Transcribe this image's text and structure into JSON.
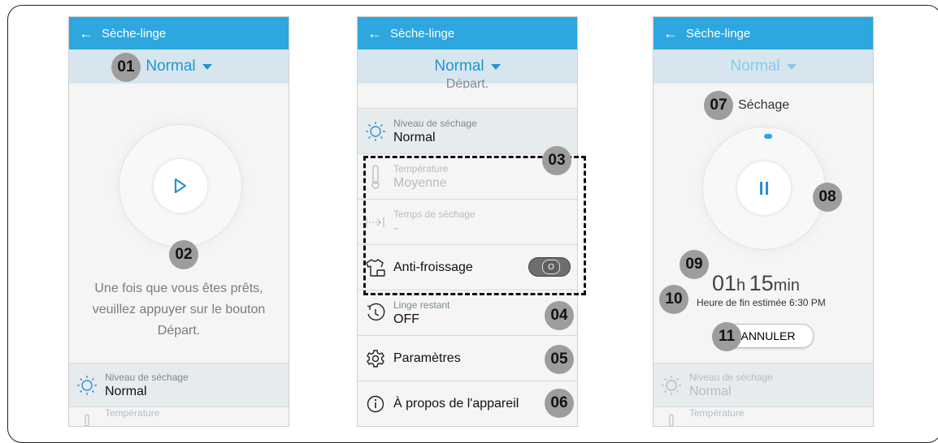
{
  "phones": [
    {
      "title": "Sèche-linge",
      "mode": "Normal",
      "badges": {
        "mode": "01",
        "dial": "02"
      },
      "message": [
        "Une fois que vous êtes prêts,",
        "veuillez appuyer sur le bouton",
        "Départ."
      ],
      "drying_level": {
        "label": "Niveau de séchage",
        "value": "Normal"
      },
      "temperature": {
        "label": "Température"
      }
    },
    {
      "title": "Sèche-linge",
      "mode": "Normal",
      "scrolled_text": "Départ.",
      "drying_level": {
        "label": "Niveau de séchage",
        "value": "Normal"
      },
      "temperature": {
        "label": "Température",
        "value": "Moyenne"
      },
      "drying_time": {
        "label": "Temps de séchage",
        "value": "-"
      },
      "anti_wrinkle": {
        "label": "Anti-froissage",
        "toggle": "O"
      },
      "remaining": {
        "label": "Linge restant",
        "value": "OFF"
      },
      "settings": "Paramètres",
      "about": "À propos de l'appareil",
      "badges": {
        "options": "03",
        "remaining": "04",
        "settings": "05",
        "about": "06"
      }
    },
    {
      "title": "Sèche-linge",
      "mode": "Normal",
      "status": "Séchage",
      "time_h": "01",
      "time_h_unit": "h",
      "time_m": "15",
      "time_m_unit": "min",
      "end_time": "Heure de fin estimée 6:30 PM",
      "cancel": "ANNULER",
      "drying_level": {
        "label": "Niveau de séchage",
        "value": "Normal"
      },
      "temperature": {
        "label": "Température"
      },
      "badges": {
        "status": "07",
        "pause": "08",
        "time": "09",
        "end": "10",
        "cancel": "11"
      }
    }
  ],
  "icons": {
    "back": "arrow-left-icon",
    "caret": "caret-down-icon",
    "play": "play-icon",
    "pause": "pause-icon",
    "sun": "sun-icon",
    "thermometer": "thermometer-icon",
    "timer": "arrow-to-bar-icon",
    "shirt": "shirt-icon",
    "clock": "clock-icon",
    "gear": "gear-icon",
    "info": "info-icon"
  },
  "colors": {
    "accent": "#2ea6df",
    "mode_bar": "#d7e6ee",
    "badge": "#9d9d9d"
  }
}
